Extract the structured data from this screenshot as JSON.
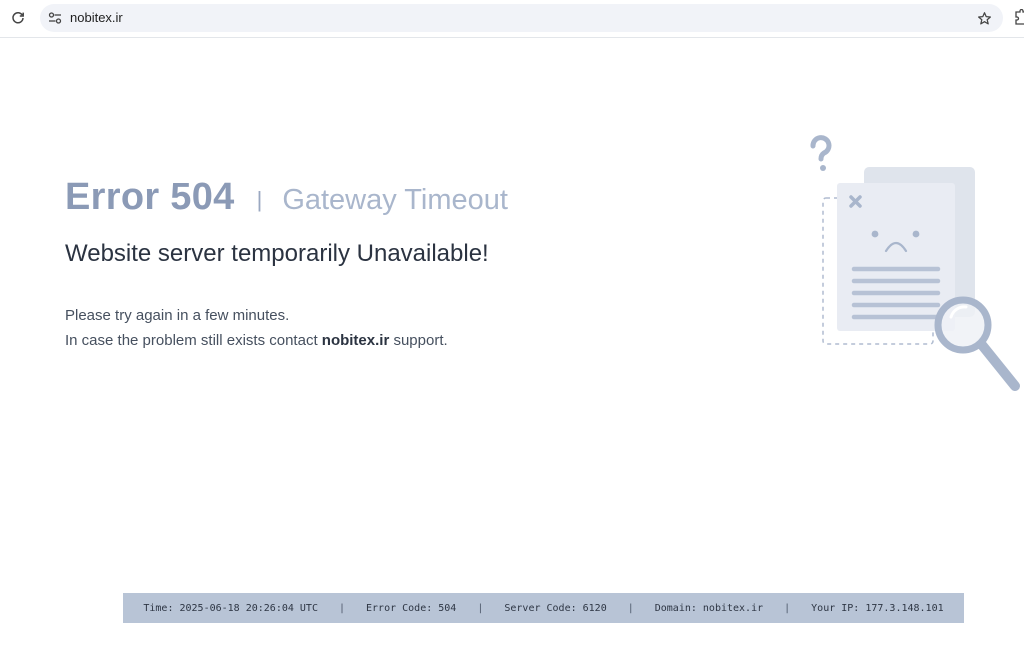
{
  "browser": {
    "url": "nobitex.ir",
    "icons": {
      "reload": "reload-icon",
      "site_info": "tune-icon",
      "bookmark": "star-icon",
      "extensions": "puzzle-icon"
    }
  },
  "error": {
    "code_text": "Error 504",
    "separator": "|",
    "name": "Gateway Timeout",
    "subtitle": "Website server temporarily Unavailable!",
    "line1": "Please try again in a few minutes.",
    "line2_prefix": "In case the problem still exists contact ",
    "line2_domain": "nobitex.ir",
    "line2_suffix": " support."
  },
  "footer": {
    "time": "Time: 2025-06-18 20:26:04 UTC",
    "error_code": "Error Code: 504",
    "server_code": "Server Code: 6120",
    "domain": "Domain: nobitex.ir",
    "ip": "Your IP: 177.3.148.101",
    "separator": "|"
  },
  "colors": {
    "accent_muted": "#8b9ab6",
    "illustration": "#a9b6cc",
    "footer_bg": "#b8c4d6",
    "text_dark": "#2b3341"
  }
}
